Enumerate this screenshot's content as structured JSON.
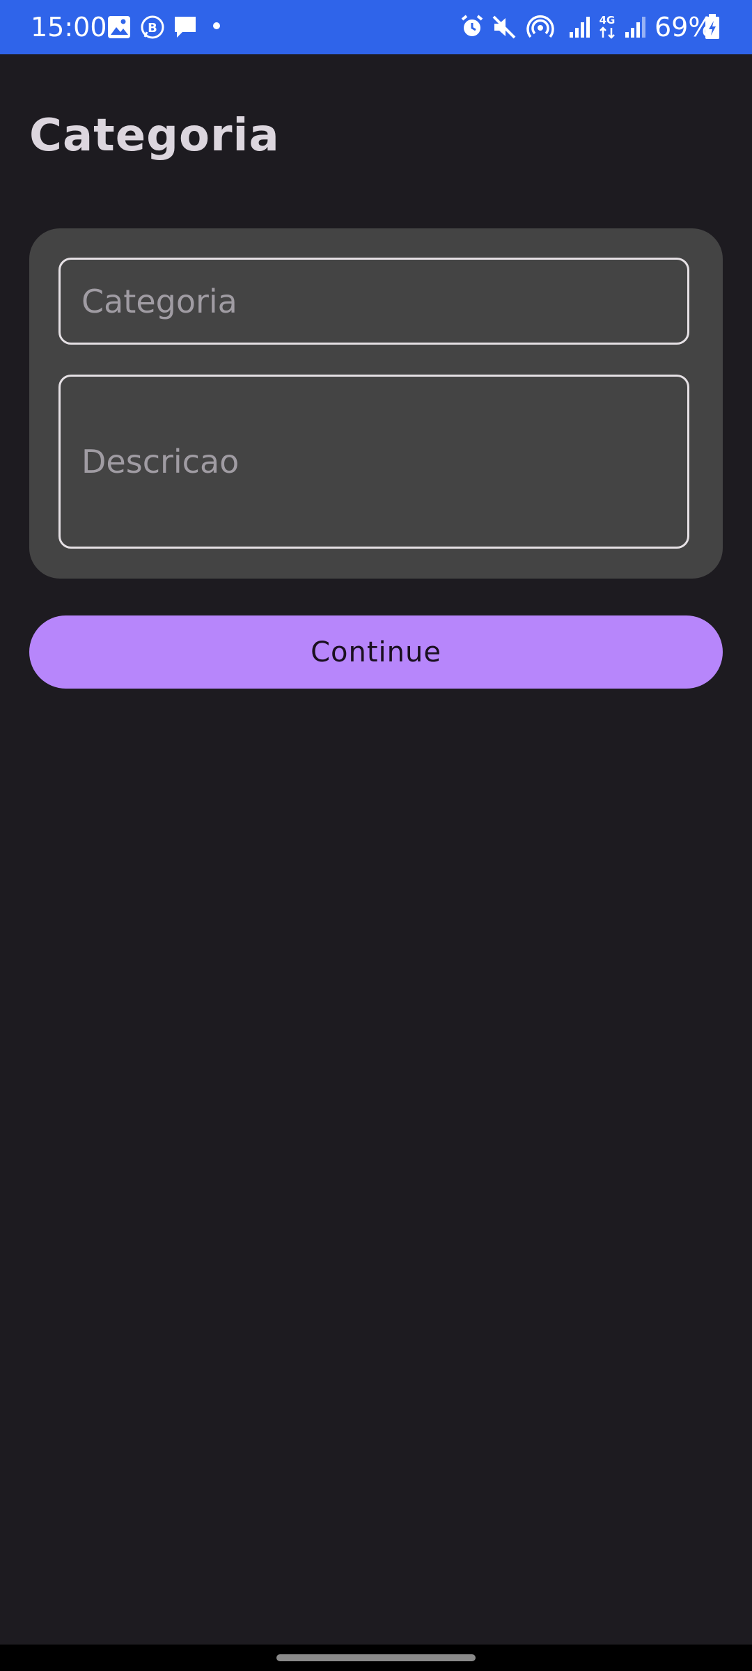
{
  "status_bar": {
    "time": "15:00",
    "battery": "69%",
    "icons_left": [
      "image-icon",
      "whatsapp-business-icon",
      "message-icon",
      "dot-icon"
    ],
    "icons_right": [
      "alarm-icon",
      "mute-icon",
      "hotspot-icon",
      "signal-icon",
      "4g-signal-icon",
      "signal-icon-2",
      "battery-charging-icon"
    ],
    "background": "#2f64ea"
  },
  "header": {
    "title": "Categoria"
  },
  "form": {
    "category_placeholder": "Categoria",
    "description_placeholder": "Descricao"
  },
  "actions": {
    "continue_label": "Continue"
  },
  "colors": {
    "background": "#1d1b20",
    "card": "#444444",
    "accent": "#b786fb",
    "field_border": "#e6e1e5"
  }
}
